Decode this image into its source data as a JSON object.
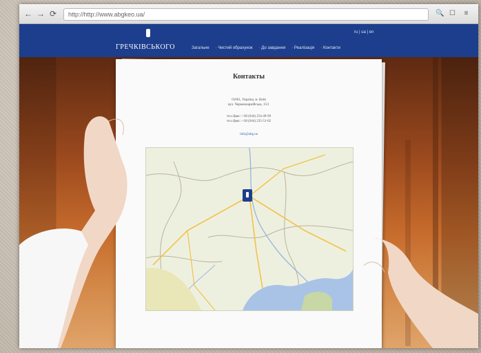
{
  "browser": {
    "url": "http://http://www.abgkeo.ua/",
    "back_icon": "back-arrow-icon",
    "forward_icon": "forward-arrow-icon",
    "reload_icon": "reload-icon"
  },
  "site": {
    "logo_text": "ГРЕЧКІВСЬКОГО",
    "nav": [
      "Загальне",
      "Чистий обрахунок",
      "До завдання",
      "Реалізація",
      "Контакти"
    ],
    "languages": "ru | ua | en"
  },
  "contacts": {
    "title": "Контакты",
    "address_line1": "01601, Україна, м. Київ",
    "address_line2": "вул. Червоноармійська, 15/1",
    "phone_line1": "тел./факс: +38 (044) 254-49-99",
    "phone_line2": "тел./факс: +38 (044) 235-51-02",
    "email": "info@abg.ua"
  },
  "colors": {
    "header_blue": "#1c3e8c",
    "pin_blue": "#1c3e8c"
  }
}
